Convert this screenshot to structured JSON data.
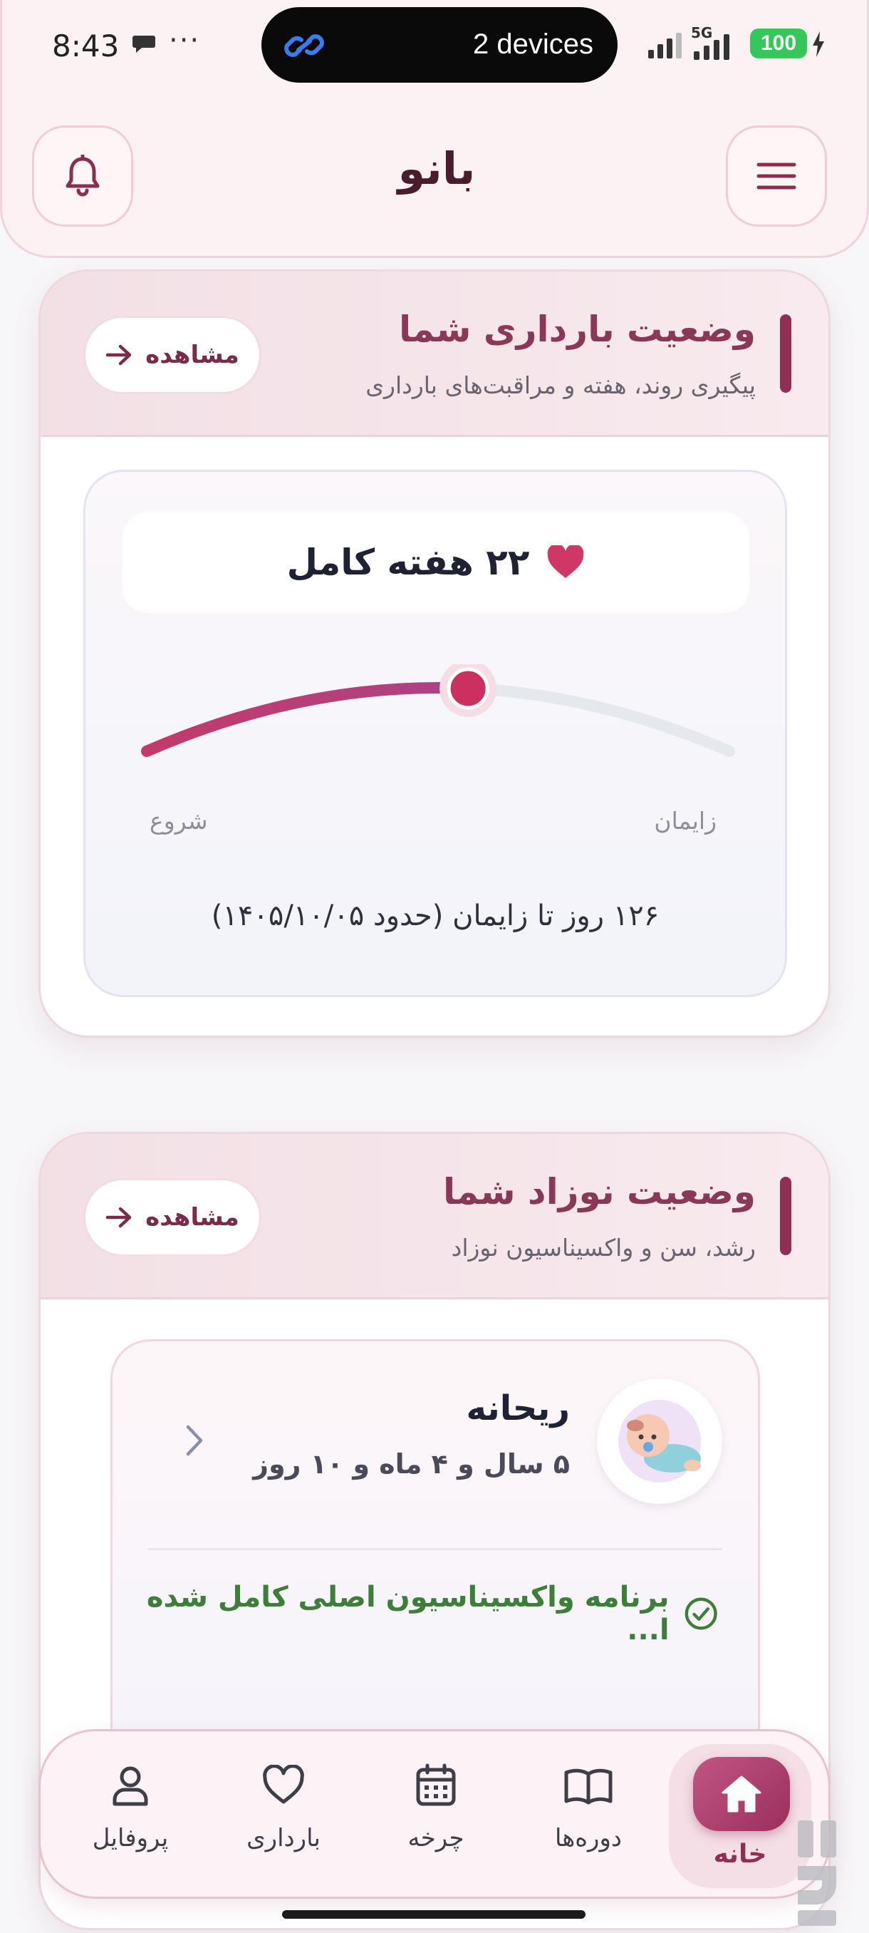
{
  "status_bar": {
    "time": "8:43",
    "dots": "···",
    "island_text": "2 devices",
    "network": "5G",
    "battery": "100"
  },
  "header": {
    "title": "بانو"
  },
  "pregnancy_card": {
    "title": "وضعیت بارداری شما",
    "subtitle": "پیگیری روند، هفته و مراقبت‌های بارداری",
    "view_label": "مشاهده",
    "week_text": "۲۲ هفته کامل",
    "progress_fraction": 0.55,
    "label_start": "شروع",
    "label_end": "زایمان",
    "days_left": "۱۲۶ روز تا زایمان (حدود ۱۴۰۵/۱۰/۰۵)"
  },
  "newborn_card": {
    "title": "وضعیت نوزاد شما",
    "subtitle": "رشد، سن و واکسیناسیون نوزاد",
    "view_label": "مشاهده",
    "baby_name": "ریحانه",
    "baby_age": "۵ سال و ۴ ماه و ۱۰ روز",
    "vaccination_status": "برنامه واکسیناسیون اصلی کامل شده ا..."
  },
  "bottom_nav": {
    "items": [
      {
        "label": "پروفایل",
        "icon": "profile-icon"
      },
      {
        "label": "بارداری",
        "icon": "heart-icon"
      },
      {
        "label": "چرخه",
        "icon": "calendar-icon"
      },
      {
        "label": "دوره‌ها",
        "icon": "book-icon"
      },
      {
        "label": "خانه",
        "icon": "home-icon",
        "active": true
      }
    ]
  },
  "colors": {
    "accent": "#8f2f56",
    "heart": "#cf3767",
    "success": "#3e7d3a"
  }
}
